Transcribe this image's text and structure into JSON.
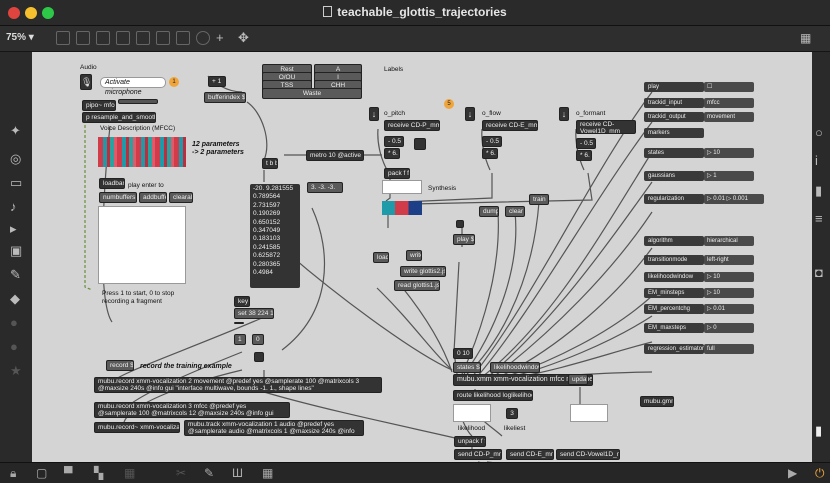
{
  "window": {
    "title": "teachable_glottis_trajectories",
    "zoom": "75% ▾"
  },
  "labels": {
    "audio": "Audio",
    "activate_microphone": "Activate microphone",
    "badge1": "1",
    "badge5": "5",
    "labels_title": "Labels",
    "voice_desc": "Voice Description (MFCC)",
    "params_note": "12 parameters\n-> 2 parameters",
    "synthesis": "Synthesis",
    "play_enter": "play enter to",
    "press_note": "Press 1 to start, 0 to stop\nrecording a fragment",
    "record_training": "record the training example",
    "likelihood": "likelihood",
    "likeliest": "likeliest",
    "o_pitch": "o_pitch",
    "o_flow": "o_flow",
    "o_formant": "o_formant"
  },
  "objects": {
    "pipo": "pipo~ mfcc",
    "p_resample": "p resample_and_smooth",
    "plus1": "+ 1",
    "bufferindex": "bufferindex $1",
    "loadbang": "loadbang",
    "numbuffers": "numbuffers 3",
    "addbuffer": "addbuffer",
    "clearall": "clearall",
    "tbb": "t b b",
    "metro": "metro 10 @active 1",
    "three": "3. -3. -3.",
    "recv_pitch": "receive CD-P_mm",
    "recv_flow": "receive CD-E_mm",
    "recv_formant": "receive CD-Vowel1D_mm",
    "p05a": "- 0.5",
    "p05b": "- 0.5",
    "p05c": "- 0.5",
    "p6a": "* 6.",
    "p6b": "* 6.",
    "p6c": "* 6.",
    "pack": "pack f f f",
    "dump": "dump",
    "clear": "clear",
    "train": "train",
    "play1": "play $1",
    "load": "load",
    "write": "write",
    "write_json": "write glottis2.json",
    "read_json": "read glottis1.json",
    "key": "key",
    "set38": "set 38 224 13",
    "one": "1",
    "zero": "0",
    "record1": "record $1",
    "zero10": "0 10",
    "states1": "states $1",
    "likelihoodwindow": "likelihoodwindow $1",
    "mubu_xmm": "mubu.xmm xmm-vocalization mfcc movement",
    "route": "route likelihood loglikelihood",
    "update": "update",
    "three_out": "3",
    "unpack": "unpack f f f",
    "send_p": "send CD-P_mm",
    "send_e": "send CD-E_mm",
    "send_v": "send CD-Vowel1D_mm",
    "mubu_gmm": "mubu.gmm",
    "mubu_record": "mubu.record xmm-vocalization 2 movement @predef yes @samplerate 100 @matrixcols 3 @maxsize 240s @info gui \"interface multiwave, bounds -1. 1., shape lines\"",
    "mubu_rec_mfcc": "mubu.record xmm-vocalization 3 mfcc @predef yes @samplerate 100 @matrixcols 12 @maxsize 240s @info gui \"interface sonogram, autobounds 1\"",
    "mubu_rec_audio": "mubu.record~ xmm-vocalization audio",
    "mubu_track": "mubu.track xmm-vocalization 1 audio @predef yes @samplerate audio @matrixcols 1 @maxsize 240s @info gui \"interface wave, bounds -1. 1.\""
  },
  "label_buttons": [
    "Rest",
    "A",
    "O/OU",
    "I",
    "TSS",
    "CHH",
    "Waste"
  ],
  "values": [
    "-20. 9.281555",
    "0.789564",
    "2.731597",
    "0.190269",
    "0.650152",
    "0.347049",
    "0.183103",
    "0.241585",
    "0.625872",
    "0.280365",
    "0.4984"
  ],
  "params": [
    {
      "label": "play",
      "value": ""
    },
    {
      "label": "trackid_input",
      "value": "mfcc"
    },
    {
      "label": "trackid_output",
      "value": "movement"
    },
    {
      "label": "markers",
      "value": ""
    },
    {
      "label": "states",
      "value": "▷ 10"
    },
    {
      "label": "gaussians",
      "value": "▷ 1"
    },
    {
      "label": "regularization",
      "value": "▷ 0.01    ▷ 0.001"
    },
    {
      "label": "algorithm",
      "value": "hierarchical"
    },
    {
      "label": "transitionmode",
      "value": "left-right"
    },
    {
      "label": "likelihoodwindow",
      "value": "▷ 10"
    },
    {
      "label": "EM_minsteps",
      "value": "▷ 10"
    },
    {
      "label": "EM_percentchg",
      "value": "▷ 0.01"
    },
    {
      "label": "EM_maxsteps",
      "value": "▷ 0"
    },
    {
      "label": "regression_estimator",
      "value": "full"
    }
  ],
  "colors": {
    "canvas": "#d4d4d4",
    "object": "#333333",
    "accent": "#f0a53c",
    "red": "#e0443e",
    "yellow": "#f5bf2e",
    "green": "#2ec848"
  }
}
